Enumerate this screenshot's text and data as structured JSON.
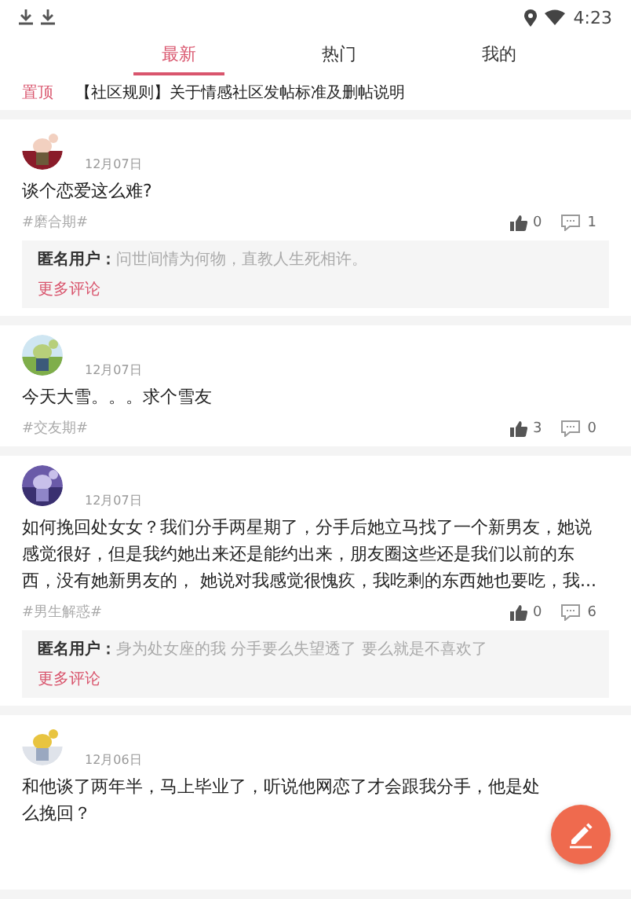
{
  "status_bar": {
    "time": "4:23"
  },
  "tabs": [
    {
      "label": "最新",
      "selected": true
    },
    {
      "label": "热门",
      "selected": false
    },
    {
      "label": "我的",
      "selected": false
    }
  ],
  "pinned": {
    "badge": "置顶",
    "title": "【社区规则】关于情感社区发帖标准及删帖说明"
  },
  "posts": [
    {
      "date": "12月07日",
      "text": [
        "谈个恋爱这么难?"
      ],
      "tag": "#磨合期#",
      "likes": "0",
      "comments": "1",
      "comment": {
        "author": "匿名用户：",
        "text": "问世间情为何物，直教人生死相许。"
      },
      "more": "更多评论"
    },
    {
      "date": "12月07日",
      "text": [
        "今天大雪。。。求个雪友"
      ],
      "tag": "#交友期#",
      "likes": "3",
      "comments": "0"
    },
    {
      "date": "12月07日",
      "text": [
        "如何挽回处女女？我们分手两星期了，分手后她立马找了一个新男友，她说感觉很好，但是我约她出来还是能约出来，朋友圈这些还是我们以前的东西，没有她新男友的， 她说对我感觉很愧疚，我吃剩的东西她也要吃，我..."
      ],
      "tag": "#男生解惑#",
      "likes": "0",
      "comments": "6",
      "comment": {
        "author": "匿名用户：",
        "text": "身为处女座的我 分手要么失望透了 要么就是不喜欢了"
      },
      "more": "更多评论"
    },
    {
      "date": "12月06日",
      "text": [
        "和他谈了两年半，马上毕业了，听说他网恋了才会跟我分手，他是处",
        "么挽回？"
      ]
    }
  ]
}
